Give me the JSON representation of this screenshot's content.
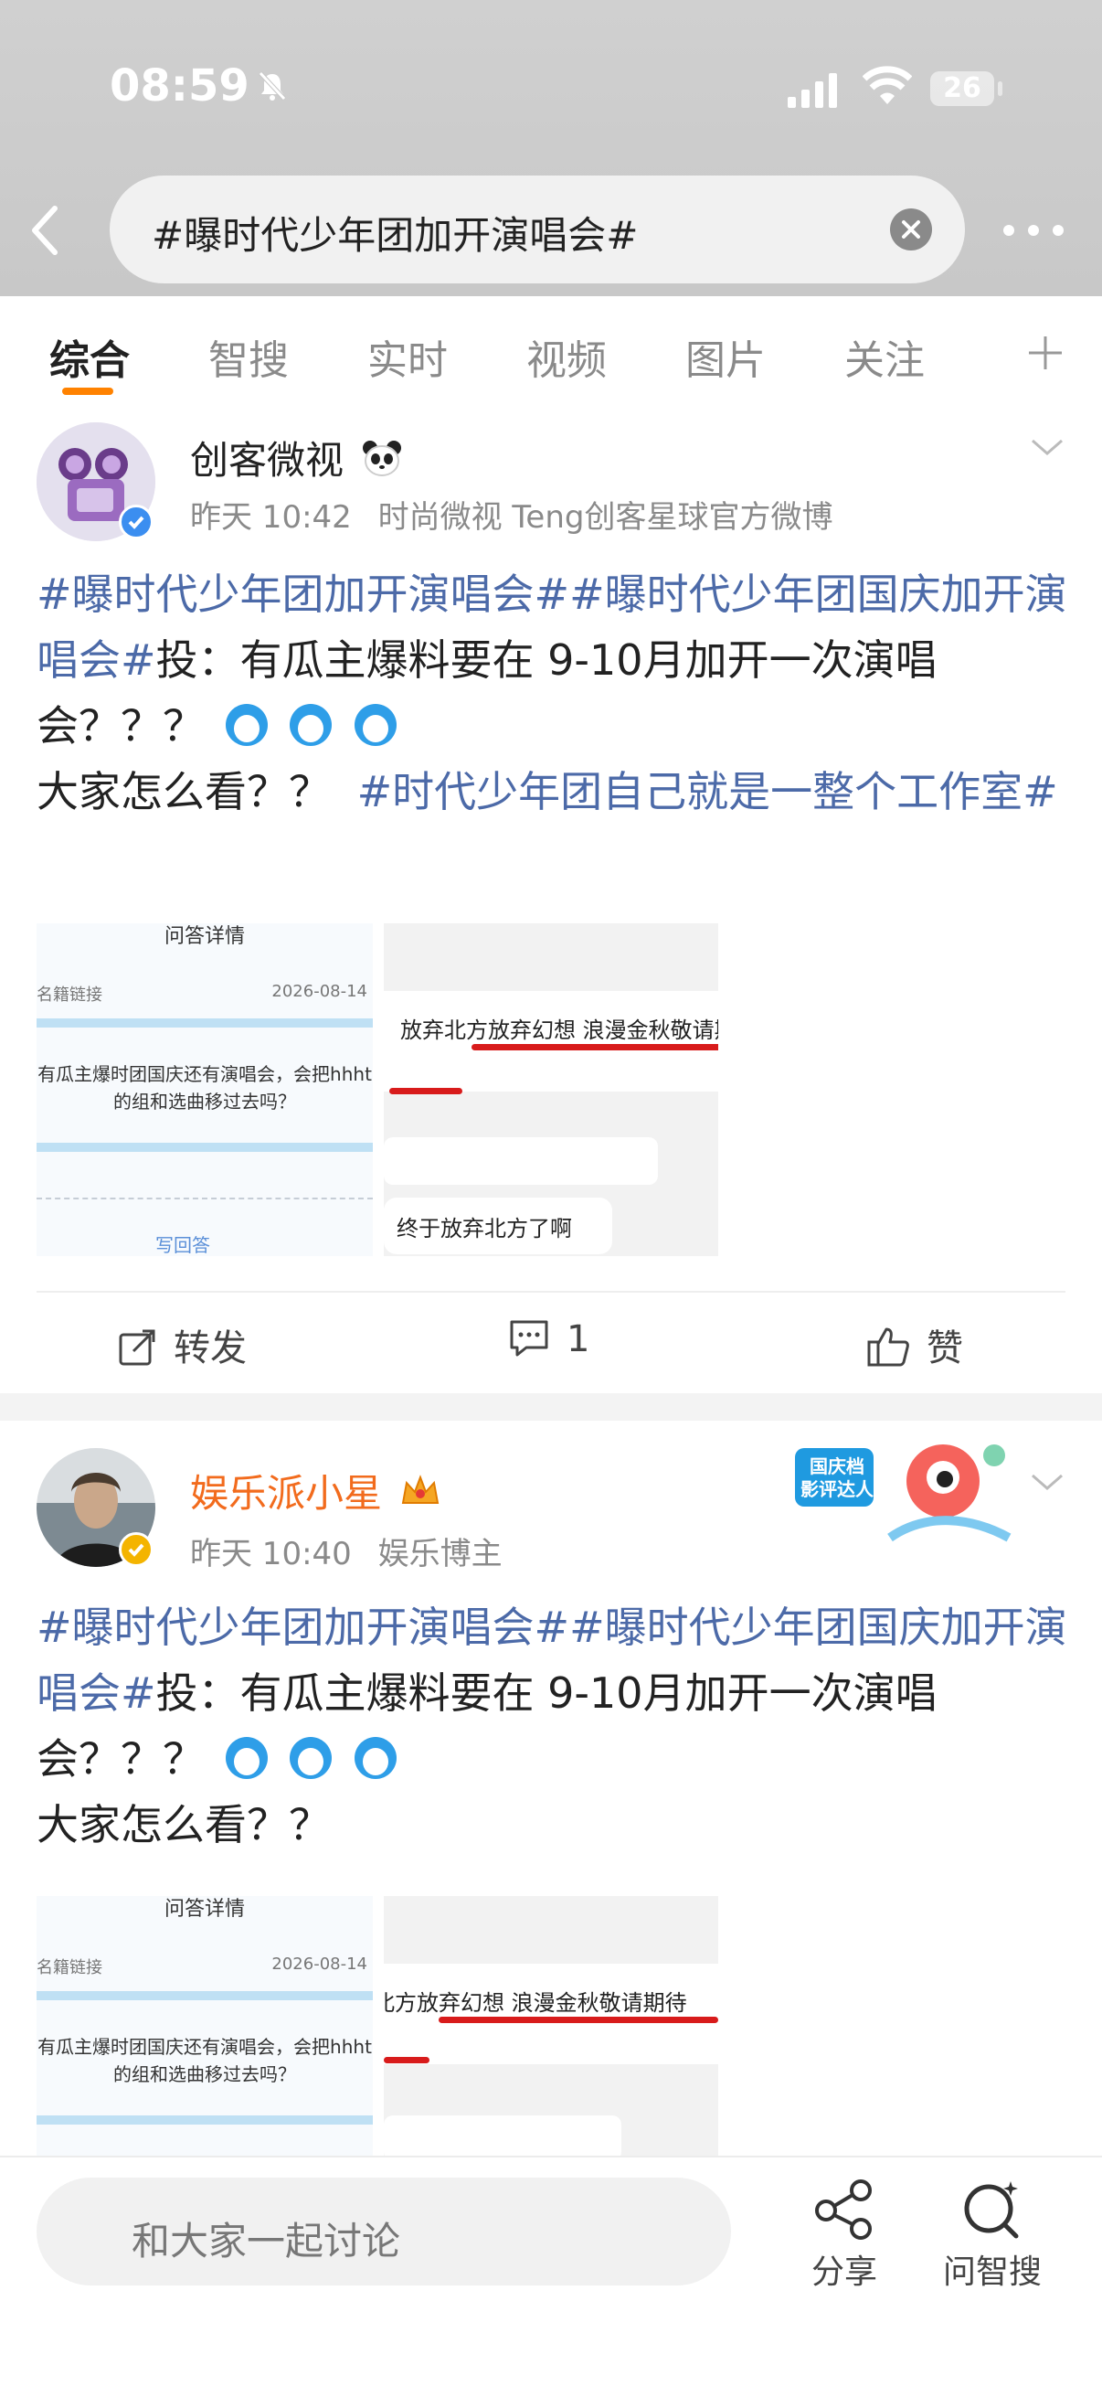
{
  "status": {
    "time": "08:59",
    "battery": "26"
  },
  "search": {
    "query": "#曝时代少年团加开演唱会#"
  },
  "tabs": [
    "综合",
    "智搜",
    "实时",
    "视频",
    "图片",
    "关注"
  ],
  "posts": [
    {
      "username": "创客微视",
      "time": "昨天 10:42",
      "source": "时尚微视 Teng创客星球官方微博",
      "tag1": "#曝时代少年团加开演唱会#",
      "tag2": "#曝时代少年团国庆加开演唱会#",
      "text1": "投：有瓜主爆料要在 9-10月加开一次演唱会？？？",
      "text2": "大家怎么看？？",
      "tag3": "#时代少年团自己就是一整个工作室#",
      "img1": {
        "top": "问答详情",
        "label": "名籍链接",
        "date": "2026-08-14",
        "question": "有瓜主爆时团国庆还有演唱会，会把hhht的组和选曲移过去吗？",
        "answer": "写回答"
      },
      "img2": {
        "line1": "放弃北方放弃幻想 浪漫金秋敬请期待",
        "line2": "终于放弃北方了啊"
      },
      "actions": {
        "repost": "转发",
        "comment": "1",
        "like": "赞"
      }
    },
    {
      "username": "娱乐派小星",
      "time": "昨天 10:40",
      "source": "娱乐博主",
      "badge": "国庆档 影评达人",
      "tag1": "#曝时代少年团加开演唱会#",
      "tag2": "#曝时代少年团国庆加开演唱会#",
      "text1": "投：有瓜主爆料要在 9-10月加开一次演唱会？？？",
      "text2": "大家怎么看？？",
      "img1": {
        "top": "问答详情",
        "label": "名籍链接",
        "date": "2026-08-14",
        "question": "有瓜主爆时团国庆还有演唱会，会把hhht的组和选曲移过去吗？"
      },
      "img2": {
        "line1": "放弃北方放弃幻想 浪漫金秋敬请期待"
      }
    }
  ],
  "bottom": {
    "placeholder": "和大家一起讨论",
    "share": "分享",
    "ask": "问智搜"
  },
  "colors": {
    "accent": "#ff8200",
    "link": "#4c6aa8",
    "verify_blue": "#3b8ef0",
    "verify_gold": "#f4b400",
    "vip_name": "#f26b1d"
  }
}
